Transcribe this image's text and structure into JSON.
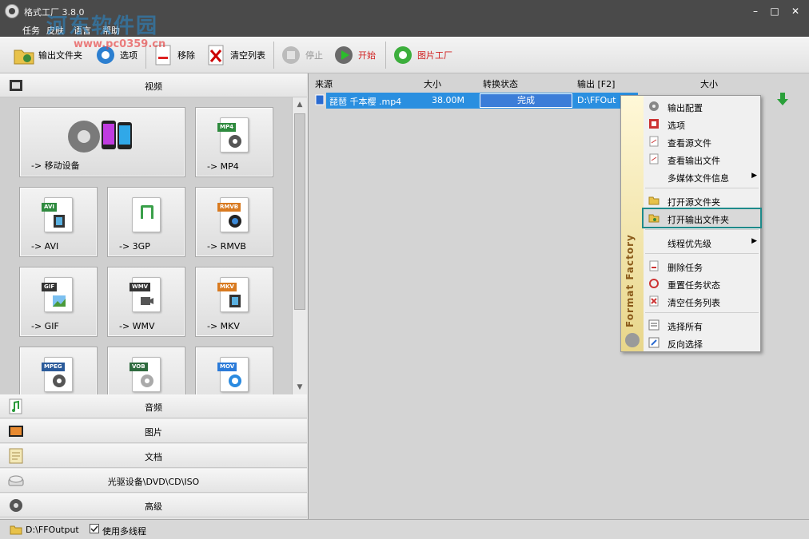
{
  "window": {
    "title": "格式工厂 3.8.0"
  },
  "watermark": {
    "cn": "河东软件园",
    "url": "www.pc0359.cn"
  },
  "menu": [
    "任务",
    "皮肤",
    "语言",
    "帮助"
  ],
  "toolbar": {
    "output_folder": "输出文件夹",
    "options": "选项",
    "remove": "移除",
    "clear_list": "清空列表",
    "stop": "停止",
    "start": "开始",
    "picture_factory": "图片工厂"
  },
  "categories": {
    "video": "视频",
    "audio": "音频",
    "picture": "图片",
    "document": "文档",
    "optical": "光驱设备\\DVD\\CD\\ISO",
    "advanced": "高级"
  },
  "tiles": [
    {
      "label": "-> 移动设备",
      "tag": ""
    },
    {
      "label": "-> MP4",
      "tag": "MP4"
    },
    {
      "label": "-> AVI",
      "tag": "AVI"
    },
    {
      "label": "-> 3GP",
      "tag": "3GP"
    },
    {
      "label": "-> RMVB",
      "tag": "RMVB"
    },
    {
      "label": "-> GIF",
      "tag": "GIF"
    },
    {
      "label": "-> WMV",
      "tag": "WMV"
    },
    {
      "label": "-> MKV",
      "tag": "MKV"
    },
    {
      "label": "",
      "tag": "MPEG"
    },
    {
      "label": "",
      "tag": "VOB"
    },
    {
      "label": "",
      "tag": "MOV"
    }
  ],
  "columns": {
    "source": "来源",
    "size": "大小",
    "status": "转换状态",
    "output": "输出 [F2]",
    "size2": "大小"
  },
  "task": {
    "name": "琵琶 千本樱 .mp4",
    "size": "38.00M",
    "status": "完成",
    "output": "D:\\FFOut"
  },
  "context_menu": {
    "items": [
      "输出配置",
      "选项",
      "查看源文件",
      "查看输出文件",
      "多媒体文件信息",
      "打开源文件夹",
      "打开输出文件夹",
      "线程优先级",
      "删除任务",
      "重置任务状态",
      "清空任务列表",
      "选择所有",
      "反向选择"
    ],
    "side_text": "Format Factory"
  },
  "status": {
    "path": "D:\\FFOutput",
    "multithread": "使用多线程"
  },
  "colors": {
    "accent": "#2a8fe0",
    "highlight_border": "#1e8a8a",
    "title_bg": "#4a4a4a"
  }
}
